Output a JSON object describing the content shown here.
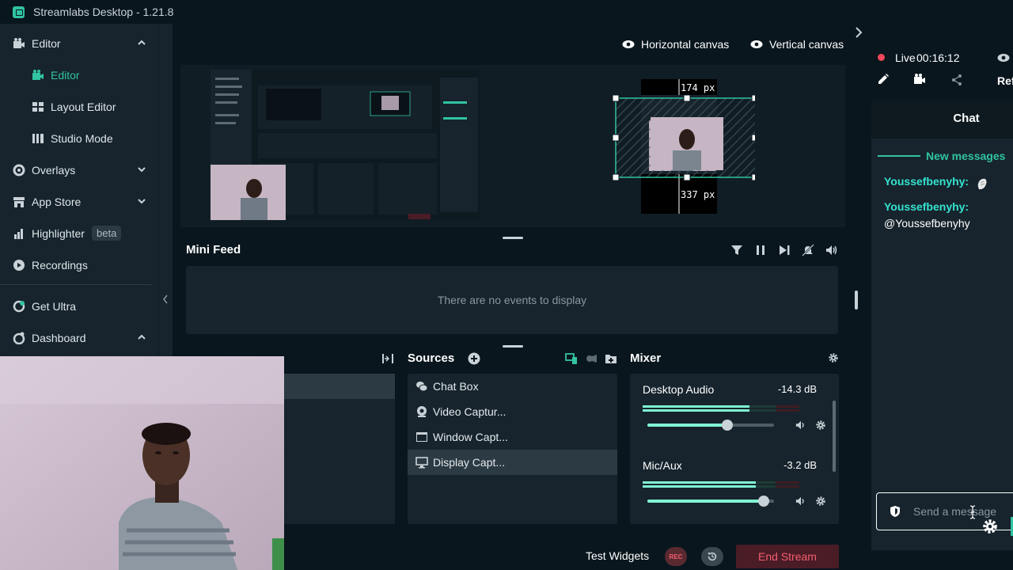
{
  "app": {
    "title": "Streamlabs Desktop - 1.21.8"
  },
  "sidebar": {
    "items": [
      {
        "label": "Editor",
        "icon": "editor-icon"
      },
      {
        "label": "Editor",
        "icon": "editor-sub-icon"
      },
      {
        "label": "Layout Editor",
        "icon": "layout-icon"
      },
      {
        "label": "Studio Mode",
        "icon": "studio-icon"
      },
      {
        "label": "Overlays",
        "icon": "overlays-icon"
      },
      {
        "label": "App Store",
        "icon": "store-icon"
      },
      {
        "label": "Highlighter",
        "icon": "highlighter-icon",
        "badge": "beta"
      },
      {
        "label": "Recordings",
        "icon": "recordings-icon"
      },
      {
        "label": "Get Ultra",
        "icon": "ultra-icon"
      },
      {
        "label": "Dashboard",
        "icon": "dashboard-icon"
      }
    ]
  },
  "canvas": {
    "horizontal_label": "Horizontal canvas",
    "vertical_label": "Vertical canvas",
    "top_px": "174 px",
    "bottom_px": "337 px"
  },
  "minifeed": {
    "title": "Mini Feed",
    "empty": "There are no events to display"
  },
  "sources": {
    "title": "Sources",
    "items": [
      "Chat Box",
      "Video Captur...",
      "Window Capt...",
      "Display Capt..."
    ]
  },
  "mixer": {
    "title": "Mixer",
    "channels": [
      {
        "name": "Desktop Audio",
        "db": "-14.3 dB",
        "level": 0.68,
        "volume": 0.63
      },
      {
        "name": "Mic/Aux",
        "db": "-3.2 dB",
        "level": 0.72,
        "volume": 0.92
      }
    ]
  },
  "footer": {
    "test_widgets": "Test Widgets",
    "rec": "REC",
    "end_stream": "End Stream"
  },
  "live": {
    "label": "Live",
    "time": "00:16:12",
    "refresh_partial": "Ref"
  },
  "chat": {
    "title": "Chat",
    "new_messages": "New messages",
    "messages": [
      {
        "name": "Youssefbenyhy:",
        "text": ""
      },
      {
        "name": "Youssefbenyhy:",
        "text": "@Youssefbenyhy"
      }
    ],
    "placeholder": "Send a message"
  },
  "colors": {
    "accent": "#31c3a2",
    "live_red": "#f0485a",
    "chat_name": "#35e3d0"
  }
}
